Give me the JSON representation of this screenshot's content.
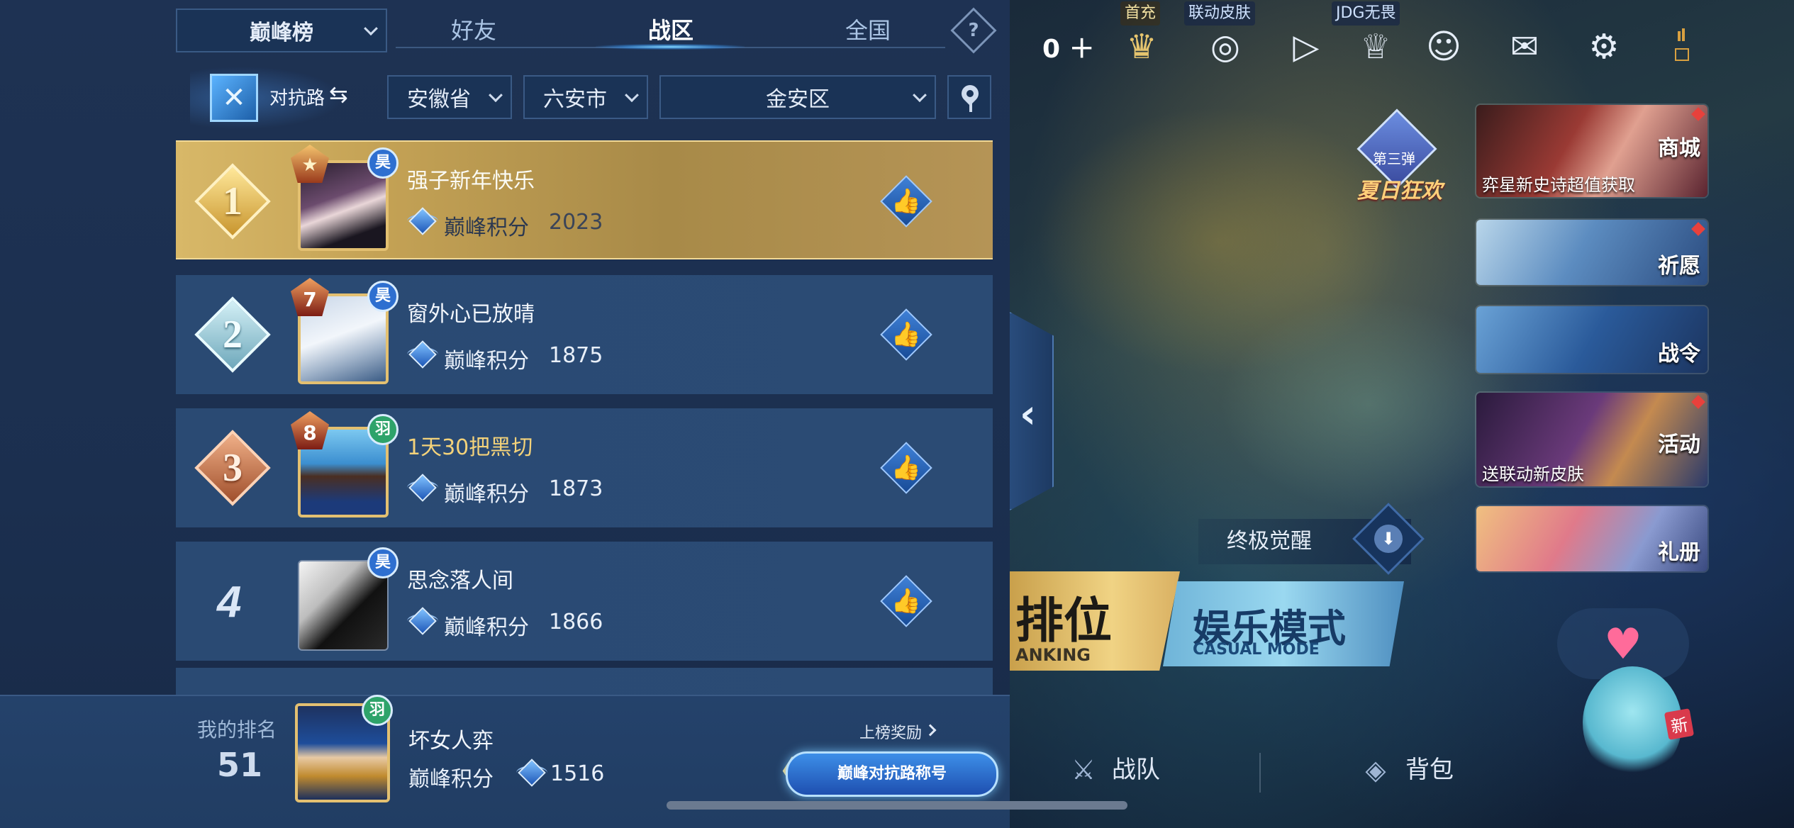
{
  "board": {
    "selector_label": "巅峰榜",
    "tabs": [
      "好友",
      "战区",
      "全国"
    ],
    "active_tab": "战区",
    "help_label": "?"
  },
  "filters": {
    "lane_label": "对抗路",
    "province": "安徽省",
    "city": "六安市",
    "district": "金安区"
  },
  "score_label": "巅峰积分",
  "rows": [
    {
      "rank": "1",
      "name": "强子新年快乐",
      "score": "2023",
      "level": "",
      "server": "昊"
    },
    {
      "rank": "2",
      "name": "窗外心已放晴",
      "score": "1875",
      "level": "7",
      "server": "昊"
    },
    {
      "rank": "3",
      "name": "1天30把黑切",
      "score": "1873",
      "level": "8",
      "server": "羽"
    },
    {
      "rank": "4",
      "name": "思念落人间",
      "score": "1866",
      "level": "",
      "server": "昊"
    }
  ],
  "my_rank": {
    "label": "我的排名",
    "value": "51",
    "name": "坏女人弈",
    "score_label": "巅峰积分",
    "score": "1516",
    "server": "羽",
    "reward_link": "上榜奖励",
    "title_banner": "巅峰对抗路称号"
  },
  "game": {
    "diamond_count": "0",
    "top_labels": [
      "首充",
      "联动皮肤",
      "JDG无畏"
    ],
    "side_cards": [
      {
        "caption": "商城",
        "subtitle": "弈星新史诗超值获取"
      },
      {
        "caption": "祈愿",
        "subtitle": ""
      },
      {
        "caption": "战令",
        "subtitle": ""
      },
      {
        "caption": "活动",
        "subtitle": "送联动新皮肤"
      },
      {
        "caption": "礼册",
        "subtitle": ""
      }
    ],
    "event_line1": "第三弹",
    "event_line2": "夏日狂欢",
    "awaken_label": "终极觉醒",
    "mode_rank": "排位",
    "mode_rank_en": "ANKING",
    "mode_casual": "娱乐模式",
    "mode_casual_en": "CASUAL MODE",
    "nav_team": "战队",
    "nav_bag": "背包",
    "mascot_new": "新"
  },
  "colors": {
    "panel_bg": "#1e3253",
    "row_bg": "#2a4a73",
    "gold_row": "#c4a255",
    "accent_blue": "#3f80d6"
  }
}
